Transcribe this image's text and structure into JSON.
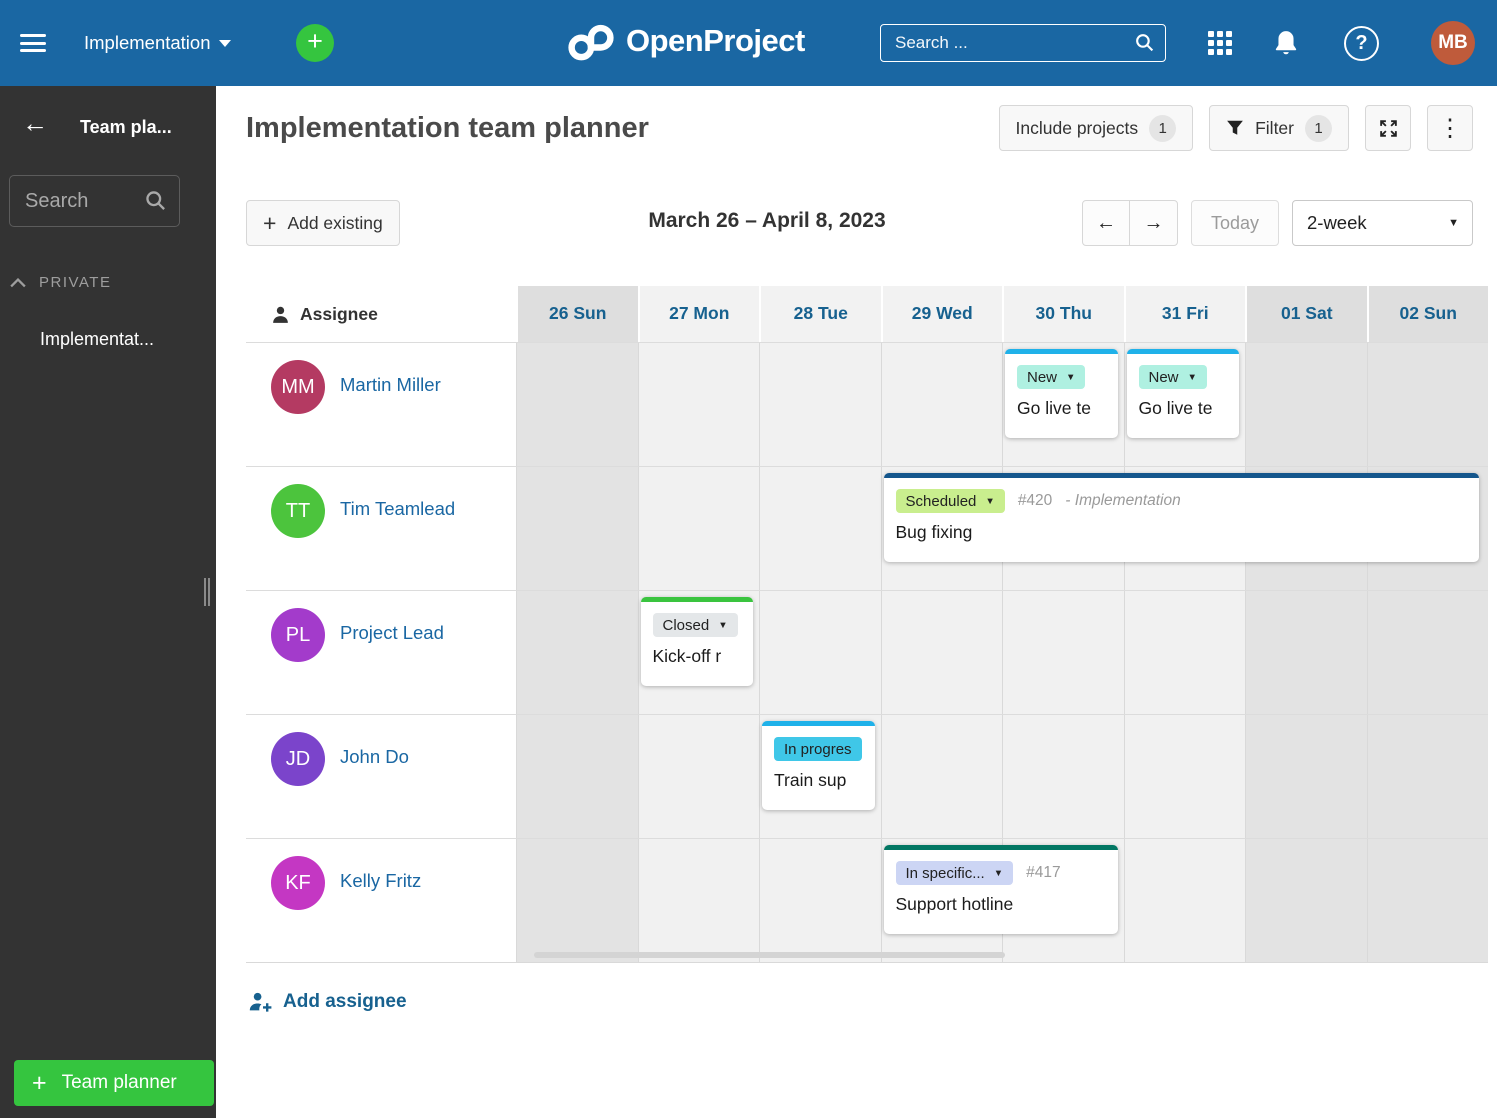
{
  "icons": {
    "caret_down": "▼",
    "kebab": "⋮",
    "back_arrow": "←",
    "arrow_left": "←",
    "arrow_right": "→",
    "plus": "+",
    "question": "?"
  },
  "navbar": {
    "background": "#1A67A3",
    "project_label": "Implementation",
    "plus_color": "#35C53F",
    "logo_text": "OpenProject",
    "search_placeholder": "Search ...",
    "avatar_initials": "MB",
    "avatar_color": "#BF5B3B"
  },
  "sidebar": {
    "title": "Team pla...",
    "search_placeholder": "Search",
    "section_label": "PRIVATE",
    "items": [
      {
        "label": "Implementat..."
      }
    ],
    "new_button_label": "Team planner",
    "new_button_color": "#35C53F"
  },
  "page_header": {
    "title": "Implementation team planner",
    "include_projects_label": "Include projects",
    "include_projects_count": "1",
    "filter_label": "Filter",
    "filter_count": "1"
  },
  "toolbar": {
    "add_existing_label": "Add existing",
    "date_range": "March 26 – April 8, 2023",
    "today_label": "Today",
    "range_select_value": "2-week"
  },
  "calendar": {
    "assignee_header": "Assignee",
    "day_text_color": "#17618F",
    "days": [
      {
        "label": "26 Sun",
        "weekend": true
      },
      {
        "label": "27 Mon",
        "weekend": false
      },
      {
        "label": "28 Tue",
        "weekend": false
      },
      {
        "label": "29 Wed",
        "weekend": false
      },
      {
        "label": "30 Thu",
        "weekend": false
      },
      {
        "label": "31 Fri",
        "weekend": false
      },
      {
        "label": "01 Sat",
        "weekend": true
      },
      {
        "label": "02 Sun",
        "weekend": true
      }
    ],
    "rows": [
      {
        "initials": "MM",
        "name": "Martin Miller",
        "avatar_color": "#B43A62",
        "cards": [
          {
            "status": "New",
            "status_caret": true,
            "badge_bg": "#AFF0E1",
            "accent": "#1FB1E9",
            "title": "Go live te",
            "col": 4,
            "span": 1
          },
          {
            "status": "New",
            "status_caret": true,
            "badge_bg": "#AFF0E1",
            "accent": "#1FB1E9",
            "title": "Go live te",
            "col": 5,
            "span": 1
          }
        ]
      },
      {
        "initials": "TT",
        "name": "Tim Teamlead",
        "avatar_color": "#4CC43D",
        "cards": [
          {
            "status": "Scheduled",
            "status_caret": true,
            "badge_bg": "#C9EE8E",
            "accent": "#14568C",
            "ref": "#420",
            "project": "- Implementation",
            "title": "Bug fixing",
            "col": 3,
            "span": 5
          }
        ]
      },
      {
        "initials": "PL",
        "name": "Project Lead",
        "avatar_color": "#A33BCB",
        "cards": [
          {
            "status": "Closed",
            "status_caret": true,
            "badge_bg": "#E4E7E9",
            "accent": "#3AC43F",
            "title": "Kick-off r",
            "col": 1,
            "span": 1
          }
        ]
      },
      {
        "initials": "JD",
        "name": "John Do",
        "avatar_color": "#7B44CB",
        "cards": [
          {
            "status": "In progres",
            "status_caret": false,
            "badge_bg": "#3FC7E8",
            "accent": "#1FB1E9",
            "title": "Train sup",
            "col": 2,
            "span": 1
          }
        ]
      },
      {
        "initials": "KF",
        "name": "Kelly Fritz",
        "avatar_color": "#C437C3",
        "cards": [
          {
            "status": "In specific...",
            "status_caret": true,
            "badge_bg": "#CCD5F4",
            "accent": "#027763",
            "ref": "#417",
            "title": "Support hotline",
            "col": 3,
            "span": 2
          }
        ]
      }
    ],
    "add_assignee_label": "Add assignee"
  }
}
